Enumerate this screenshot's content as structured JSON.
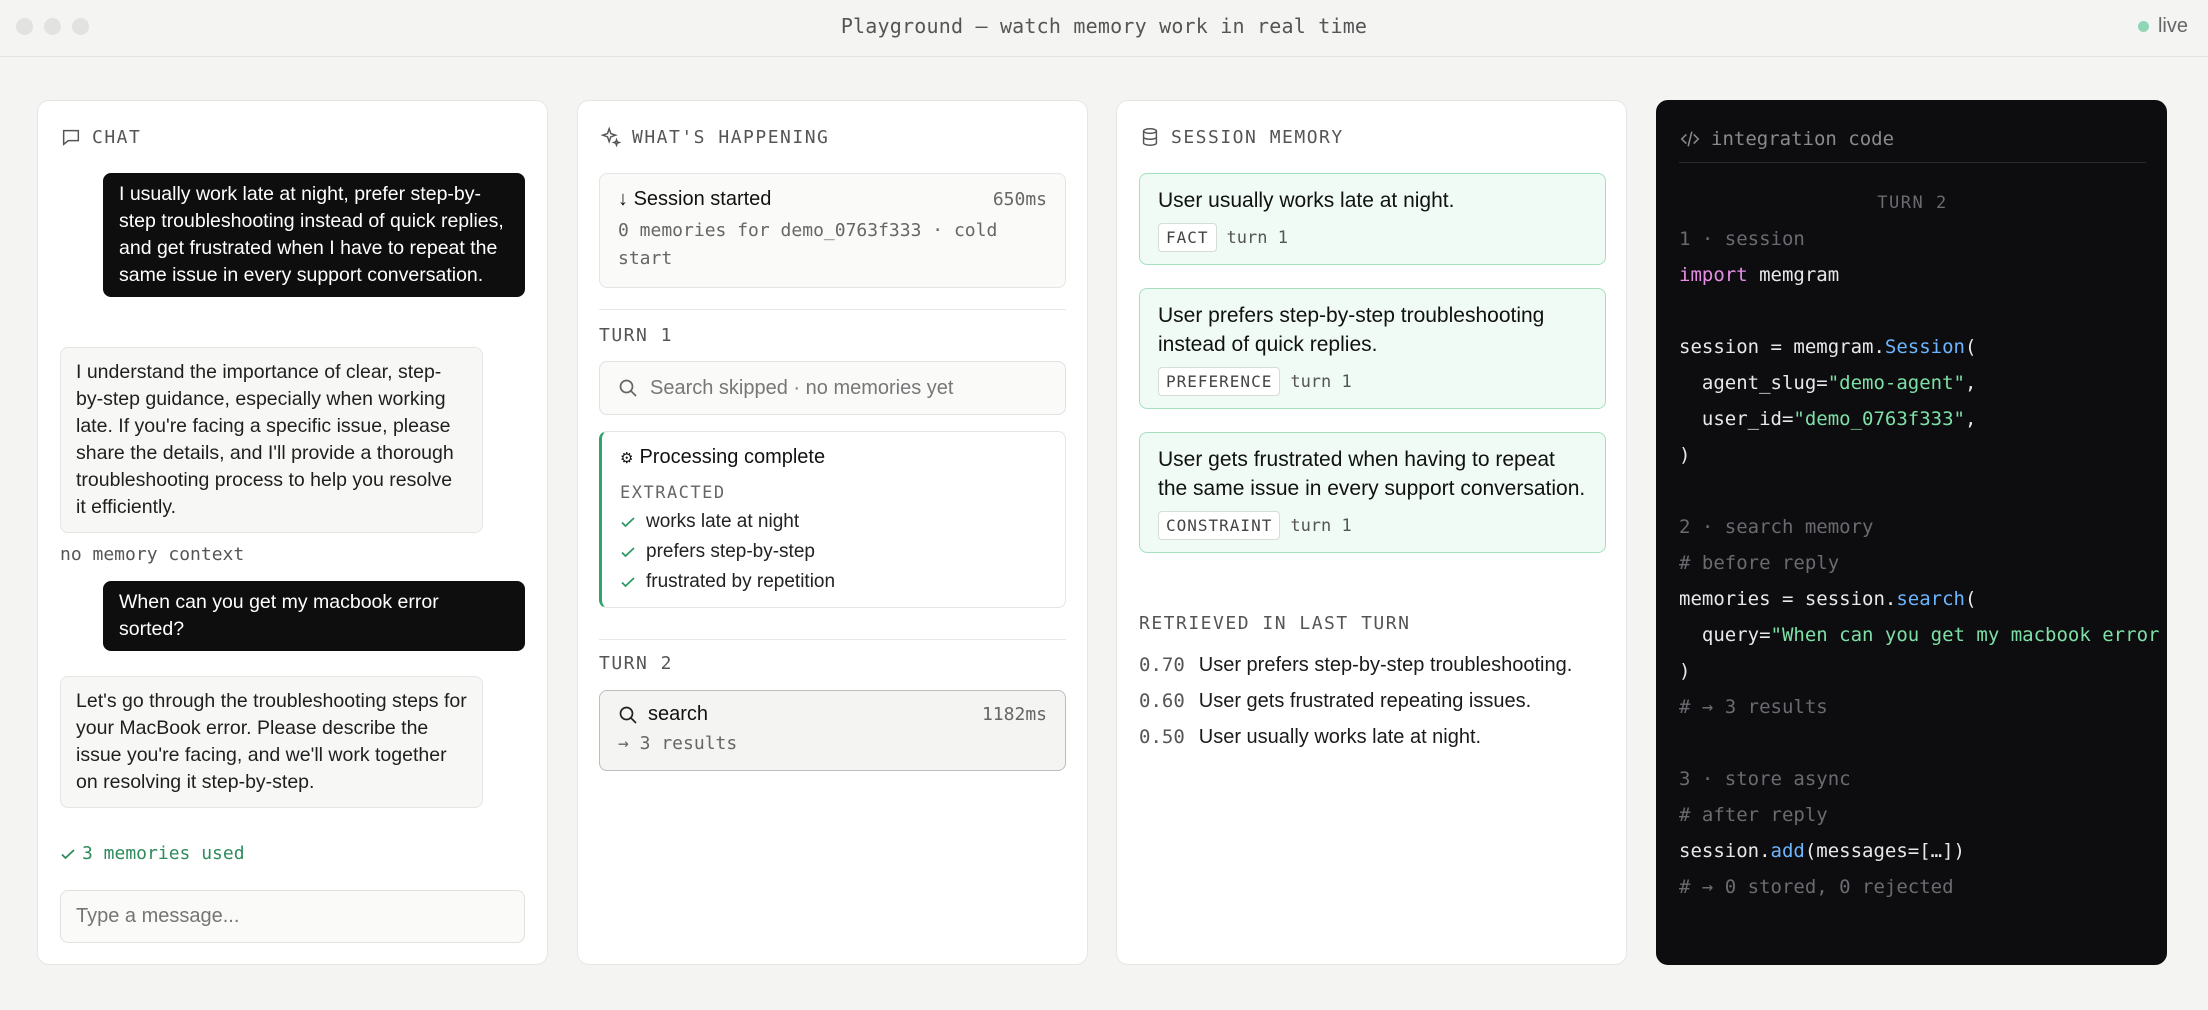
{
  "window": {
    "title": "Playground — watch memory work in real time",
    "status": "live",
    "status_color": "#8fd6b4"
  },
  "chat": {
    "header": "CHAT",
    "messages": [
      {
        "role": "user",
        "text": "I usually work late at night, prefer step-by-step troubleshooting instead of quick replies, and get frustrated when I have to repeat the same issue in every support conversation."
      },
      {
        "role": "assistant",
        "text": "I understand the importance of clear, step-by-step guidance, especially when working late. If you're facing a specific issue, please share the details, and I'll provide a thorough troubleshooting process to help you resolve it efficiently.",
        "meta": "no memory context"
      },
      {
        "role": "user",
        "text": "When can you get my macbook error sorted?"
      },
      {
        "role": "assistant",
        "text": "Let's go through the troubleshooting steps for your MacBook error. Please describe the issue you're facing, and we'll work together on resolving it step-by-step.",
        "meta": "3 memories used"
      }
    ],
    "input_placeholder": "Type a message..."
  },
  "happening": {
    "header": "WHAT'S HAPPENING",
    "session": {
      "title": "Session started",
      "time": "650ms",
      "detail": "0 memories for demo_0763f333 · cold start"
    },
    "turn1": {
      "label": "TURN 1",
      "search_skipped": "Search skipped · no memories yet",
      "processing_title": "Processing complete",
      "extracted_label": "EXTRACTED",
      "extracted": [
        "works late at night",
        "prefers step-by-step",
        "frustrated by repetition"
      ]
    },
    "turn2": {
      "label": "TURN 2",
      "search_title": "search",
      "search_time": "1182ms",
      "search_result": "→ 3 results"
    }
  },
  "memory": {
    "header": "SESSION MEMORY",
    "items": [
      {
        "text": "User usually works late at night.",
        "tag": "FACT",
        "turn": "turn 1"
      },
      {
        "text": "User prefers step-by-step troubleshooting instead of quick replies.",
        "tag": "PREFERENCE",
        "turn": "turn 1"
      },
      {
        "text": "User gets frustrated when having to repeat the same issue in every support conversation.",
        "tag": "CONSTRAINT",
        "turn": "turn 1"
      }
    ],
    "retrieved_label": "RETRIEVED IN LAST TURN",
    "retrieved": [
      {
        "score": "0.70",
        "text": "User prefers step-by-step troubleshooting."
      },
      {
        "score": "0.60",
        "text": "User gets frustrated repeating issues."
      },
      {
        "score": "0.50",
        "text": "User usually works late at night."
      }
    ]
  },
  "code": {
    "header": "integration code",
    "turn_label": "TURN 2",
    "step1": "1 · session",
    "step2": "2 · search memory",
    "step3": "3 · store async",
    "comment_before": "# before reply",
    "comment_results": "# → 3 results",
    "comment_after": "# after reply",
    "comment_stored": "# → 0 stored, 0 rejected",
    "agent_slug": "\"demo-agent\"",
    "user_id": "\"demo_0763f333\"",
    "query": "\"When can you get my macbook error sorted?\""
  }
}
